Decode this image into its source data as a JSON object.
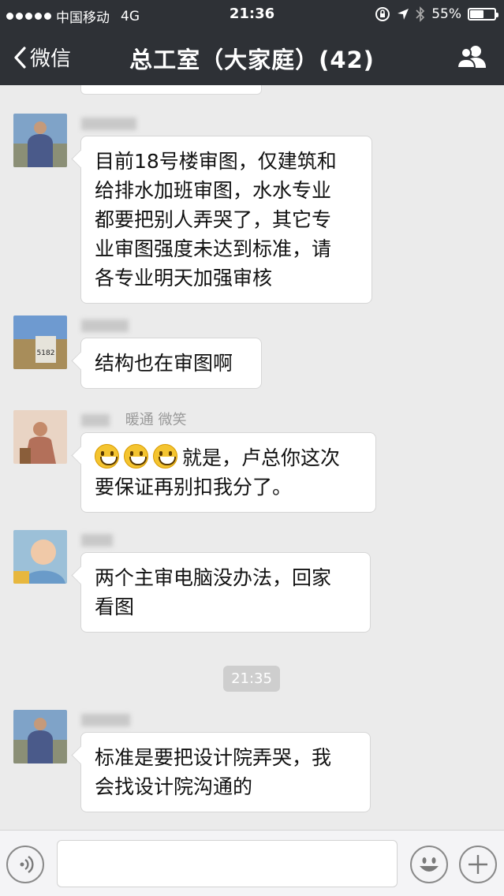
{
  "status": {
    "carrier": "中国移动",
    "network": "4G",
    "time": "21:36",
    "battery": "55%",
    "battery_level": 0.55
  },
  "nav": {
    "back_label": "微信",
    "title": "总工室（大家庭）(42)"
  },
  "messages": [
    {
      "sender": "",
      "text_lines": [
        "目前18号楼审图，仅建筑和",
        "给排水加班审图，水水专业",
        "都要把别人弄哭了，其它专",
        "业审图强度未达到标准，请",
        "各专业明天加强审核"
      ]
    },
    {
      "sender": "",
      "text_lines": [
        "结构也在审图啊"
      ]
    },
    {
      "sender": "暖通  微笑",
      "text_lines": [
        "就是，卢总你这次",
        "要保证再别扣我分了。"
      ]
    },
    {
      "sender": "",
      "text_lines": [
        "两个主审电脑没办法，回家",
        "看图"
      ]
    },
    {
      "sender": "",
      "text_lines": [
        "标准是要把设计院弄哭，我",
        "会找设计院沟通的"
      ]
    }
  ],
  "timestamp": "21:35",
  "icons": {
    "back": "chevron-left-icon",
    "group": "group-members-icon",
    "voice": "voice-icon",
    "emoji": "emoji-icon",
    "more": "plus-icon"
  },
  "colors": {
    "topbar": "#2e3136",
    "chat_bg": "#ebebeb",
    "bubble": "#ffffff"
  }
}
